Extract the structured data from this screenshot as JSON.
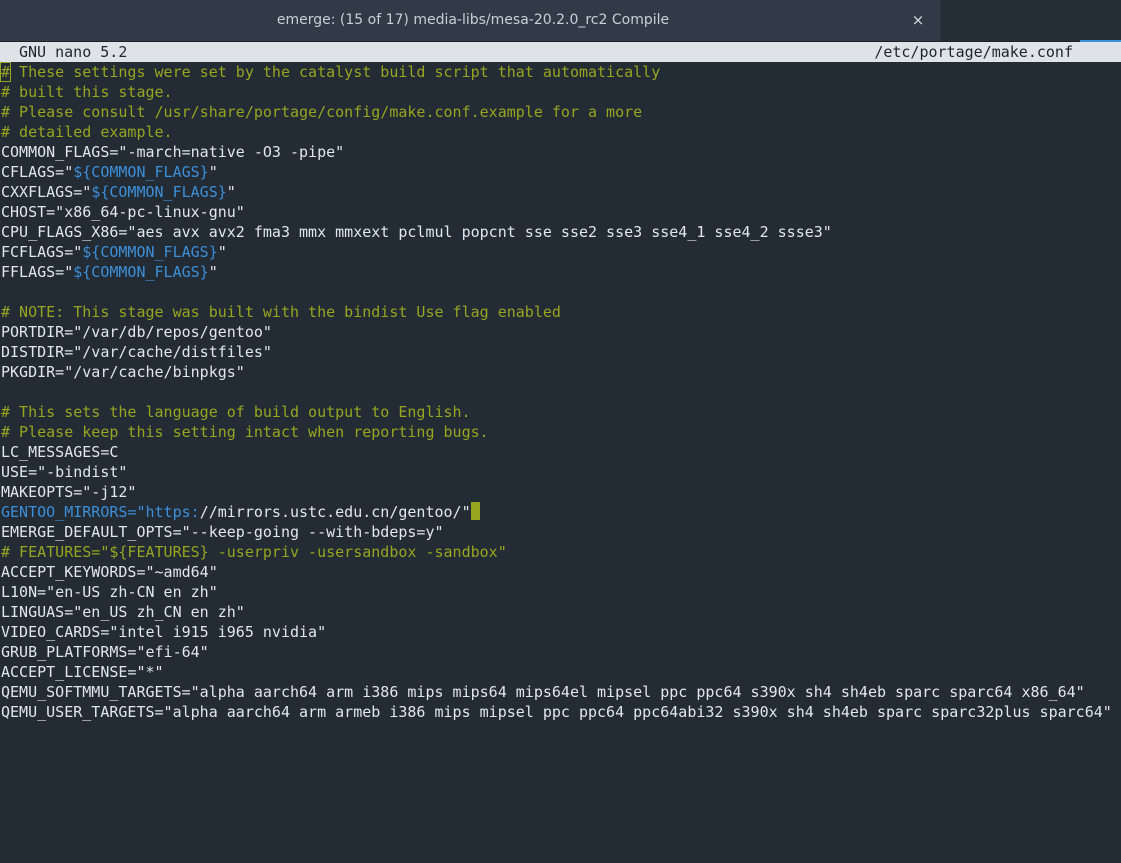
{
  "window": {
    "tab_title": "emerge: (15 of 17) media-libs/mesa-20.2.0_rc2 Compile",
    "close_glyph": "×"
  },
  "nano": {
    "version": "GNU nano 5.2",
    "filename": "/etc/portage/make.conf"
  },
  "colors": {
    "background": "#232b35",
    "comment": "#97a51f",
    "variable": "#3d8fd8",
    "text": "#e3e6ea",
    "header_bg": "#dfe3e7"
  },
  "lines": [
    {
      "segments": [
        {
          "type": "cursor",
          "text": "#"
        },
        {
          "type": "comment",
          "text": " These settings were set by the catalyst build script that automatically"
        }
      ]
    },
    {
      "segments": [
        {
          "type": "comment",
          "text": "# built this stage."
        }
      ]
    },
    {
      "segments": [
        {
          "type": "comment",
          "text": "# Please consult /usr/share/portage/config/make.conf.example for a more"
        }
      ]
    },
    {
      "segments": [
        {
          "type": "comment",
          "text": "# detailed example."
        }
      ]
    },
    {
      "segments": [
        {
          "type": "plain",
          "text": "COMMON_FLAGS=\"-march=native -O3 -pipe\""
        }
      ]
    },
    {
      "segments": [
        {
          "type": "plain",
          "text": "CFLAGS=\""
        },
        {
          "type": "var",
          "text": "${COMMON_FLAGS}"
        },
        {
          "type": "plain",
          "text": "\""
        }
      ]
    },
    {
      "segments": [
        {
          "type": "plain",
          "text": "CXXFLAGS=\""
        },
        {
          "type": "var",
          "text": "${COMMON_FLAGS}"
        },
        {
          "type": "plain",
          "text": "\""
        }
      ]
    },
    {
      "segments": [
        {
          "type": "plain",
          "text": "CHOST=\"x86_64-pc-linux-gnu\""
        }
      ]
    },
    {
      "segments": [
        {
          "type": "plain",
          "text": "CPU_FLAGS_X86=\"aes avx avx2 fma3 mmx mmxext pclmul popcnt sse sse2 sse3 sse4_1 sse4_2 ssse3\""
        }
      ]
    },
    {
      "segments": [
        {
          "type": "plain",
          "text": "FCFLAGS=\""
        },
        {
          "type": "var",
          "text": "${COMMON_FLAGS}"
        },
        {
          "type": "plain",
          "text": "\""
        }
      ]
    },
    {
      "segments": [
        {
          "type": "plain",
          "text": "FFLAGS=\""
        },
        {
          "type": "var",
          "text": "${COMMON_FLAGS}"
        },
        {
          "type": "plain",
          "text": "\""
        }
      ]
    },
    {
      "segments": []
    },
    {
      "segments": [
        {
          "type": "comment",
          "text": "# NOTE: This stage was built with the bindist Use flag enabled"
        }
      ]
    },
    {
      "segments": [
        {
          "type": "plain",
          "text": "PORTDIR=\"/var/db/repos/gentoo\""
        }
      ]
    },
    {
      "segments": [
        {
          "type": "plain",
          "text": "DISTDIR=\"/var/cache/distfiles\""
        }
      ]
    },
    {
      "segments": [
        {
          "type": "plain",
          "text": "PKGDIR=\"/var/cache/binpkgs\""
        }
      ]
    },
    {
      "segments": []
    },
    {
      "segments": [
        {
          "type": "comment",
          "text": "# This sets the language of build output to English."
        }
      ]
    },
    {
      "segments": [
        {
          "type": "comment",
          "text": "# Please keep this setting intact when reporting bugs."
        }
      ]
    },
    {
      "segments": [
        {
          "type": "plain",
          "text": "LC_MESSAGES=C"
        }
      ]
    },
    {
      "segments": [
        {
          "type": "plain",
          "text": "USE=\"-bindist\""
        }
      ]
    },
    {
      "segments": [
        {
          "type": "plain",
          "text": "MAKEOPTS=\"-j12\""
        }
      ]
    },
    {
      "segments": [
        {
          "type": "var",
          "text": "GENTOO_MIRRORS=\"https:"
        },
        {
          "type": "plain",
          "text": "//mirrors.ustc.edu.cn/gentoo/\""
        },
        {
          "type": "block",
          "text": ""
        }
      ]
    },
    {
      "segments": [
        {
          "type": "plain",
          "text": "EMERGE_DEFAULT_OPTS=\"--keep-going --with-bdeps=y\""
        }
      ]
    },
    {
      "segments": [
        {
          "type": "comment",
          "text": "# FEATURES=\"${FEATURES} -userpriv -usersandbox -sandbox\""
        }
      ]
    },
    {
      "segments": [
        {
          "type": "plain",
          "text": "ACCEPT_KEYWORDS=\"~amd64\""
        }
      ]
    },
    {
      "segments": [
        {
          "type": "plain",
          "text": "L10N=\"en-US zh-CN en zh\""
        }
      ]
    },
    {
      "segments": [
        {
          "type": "plain",
          "text": "LINGUAS=\"en_US zh_CN en zh\""
        }
      ]
    },
    {
      "segments": [
        {
          "type": "plain",
          "text": "VIDEO_CARDS=\"intel i915 i965 nvidia\""
        }
      ]
    },
    {
      "segments": [
        {
          "type": "plain",
          "text": "GRUB_PLATFORMS=\"efi-64\""
        }
      ]
    },
    {
      "segments": [
        {
          "type": "plain",
          "text": "ACCEPT_LICENSE=\"*\""
        }
      ]
    },
    {
      "segments": [
        {
          "type": "plain",
          "text": "QEMU_SOFTMMU_TARGETS=\"alpha aarch64 arm i386 mips mips64 mips64el mipsel ppc ppc64 s390x sh4 sh4eb sparc sparc64 x86_64\""
        }
      ]
    },
    {
      "segments": [
        {
          "type": "plain",
          "text": "QEMU_USER_TARGETS=\"alpha aarch64 arm armeb i386 mips mipsel ppc ppc64 ppc64abi32 s390x sh4 sh4eb sparc sparc32plus sparc64\""
        }
      ]
    }
  ]
}
